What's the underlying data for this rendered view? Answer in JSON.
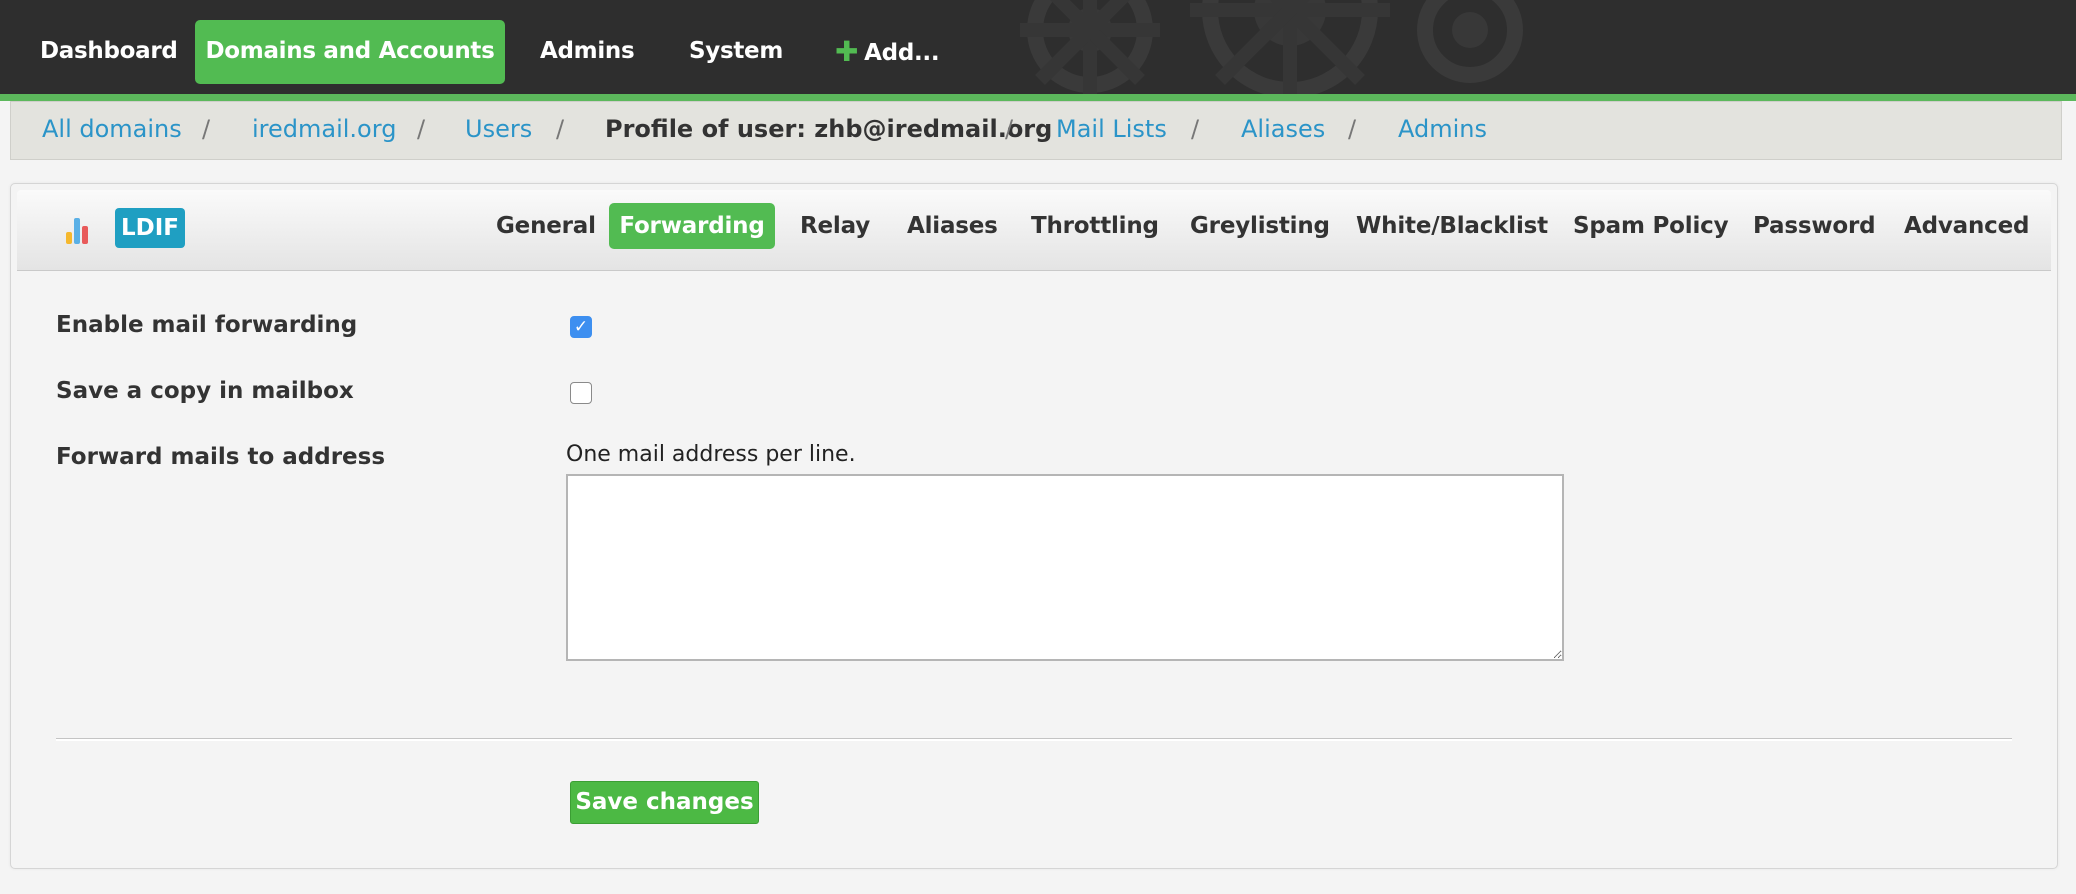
{
  "nav": {
    "dashboard": "Dashboard",
    "domains_accounts": "Domains and Accounts",
    "admins": "Admins",
    "system": "System",
    "add": "Add..."
  },
  "breadcrumb": {
    "all_domains": "All domains",
    "domain": "iredmail.org",
    "users": "Users",
    "profile": "Profile of user: zhb@iredmail.org",
    "mail_lists": "Mail Lists",
    "aliases": "Aliases",
    "admins": "Admins",
    "separator": "/"
  },
  "panel": {
    "ldif_label": "LDIF",
    "tabs": [
      "General",
      "Forwarding",
      "Relay",
      "Aliases",
      "Throttling",
      "Greylisting",
      "White/Blacklist",
      "Spam Policy",
      "Password",
      "Advanced"
    ],
    "active_tab": "Forwarding"
  },
  "form": {
    "enable_forwarding_label": "Enable mail forwarding",
    "enable_forwarding_checked": true,
    "save_copy_label": "Save a copy in mailbox",
    "save_copy_checked": false,
    "forward_to_label": "Forward mails to address",
    "forward_hint": "One mail address per line.",
    "forward_addresses_value": "",
    "save_button": "Save changes"
  },
  "colors": {
    "accent_green": "#52bb52",
    "link_blue": "#2b94c8",
    "ldif_blue": "#1f9fc2",
    "topbar": "#2e2e2e"
  },
  "icons": [
    "plus-icon",
    "chart-icon",
    "checkmark-icon",
    "gears-decoration"
  ]
}
